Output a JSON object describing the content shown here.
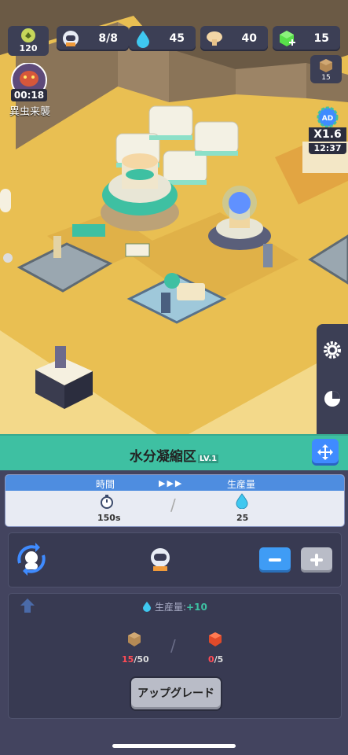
{
  "hud": {
    "coins": "120",
    "workers": "8/8",
    "water": "45",
    "food": "40",
    "gems": "15",
    "crate_count": "15"
  },
  "alert": {
    "timer": "00:18",
    "label": "異虫来襲"
  },
  "boost": {
    "ad_label": "AD",
    "multiplier": "X1.6",
    "time": "12:37"
  },
  "building": {
    "name": "水分凝縮区",
    "level": "LV.1"
  },
  "production": {
    "time_header": "時間",
    "arrows": "▶▶▶",
    "output_header": "生産量",
    "time_value": "150s",
    "output_value": "25",
    "separator": "/"
  },
  "upgrade": {
    "rate_label": "生産量:",
    "rate_value": "+10",
    "mat1_have": "15",
    "mat1_need": "/50",
    "mat2_have": "0",
    "mat2_need": "/5",
    "separator": "/",
    "button_label": "アップグレード"
  },
  "colors": {
    "accent_green": "#3ec0a2",
    "accent_blue": "#3f8bff",
    "panel": "#383a52",
    "warning_red": "#ff4b55"
  }
}
